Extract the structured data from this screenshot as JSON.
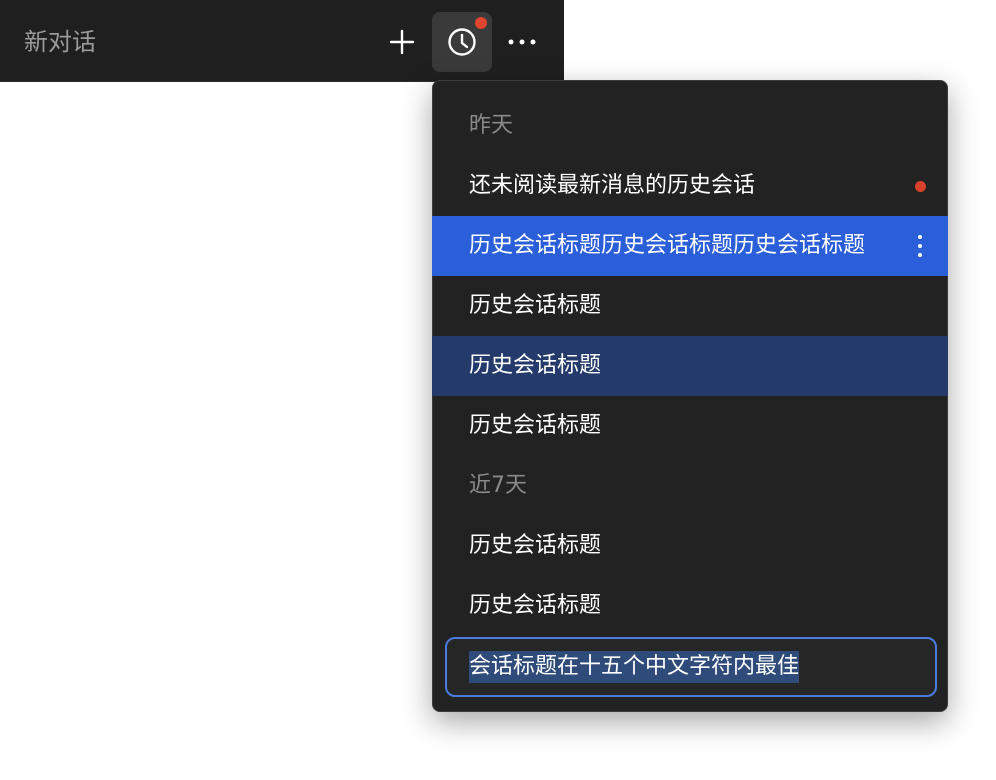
{
  "header": {
    "title": "新对话",
    "new_icon": "plus-icon",
    "history_icon": "clock-icon",
    "more_icon": "more-horizontal-icon",
    "history_has_notification": true
  },
  "history": {
    "sections": [
      {
        "label": "昨天",
        "items": [
          {
            "title": "还未阅读最新消息的历史会话",
            "unread": true
          },
          {
            "title": "历史会话标题历史会话标题历史会话标题",
            "selected": true
          },
          {
            "title": "历史会话标题"
          },
          {
            "title": "历史会话标题",
            "hovered": true
          },
          {
            "title": "历史会话标题"
          }
        ]
      },
      {
        "label": "近7天",
        "items": [
          {
            "title": "历史会话标题"
          },
          {
            "title": "历史会话标题"
          }
        ]
      }
    ],
    "rename": {
      "value": "会话标题在十五个中文字符内最佳"
    }
  },
  "colors": {
    "selected": "#2b5fd9",
    "hovered": "#233a6b",
    "unread_dot": "#d9402b",
    "focus_border": "#4a7be0"
  }
}
